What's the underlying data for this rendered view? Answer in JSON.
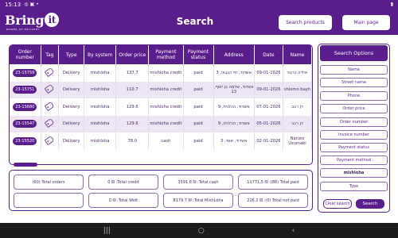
{
  "status_bar": {
    "time": "15:13",
    "icons_left": [
      "whatsapp-icon",
      "notification-icon",
      "dot"
    ],
    "battery": "battery-icon"
  },
  "app": {
    "logo_text": "Bring",
    "logo_it": "it",
    "logo_sub": "POWER OF DELIVERY",
    "title": "Search",
    "search_products": "Search products",
    "main_page": "Main page",
    "accent": "#5a1e8c"
  },
  "table": {
    "headers": [
      "Order number",
      "Tag",
      "Type",
      "By system",
      "Order price",
      "Payment method",
      "Payment status",
      "Address",
      "Date",
      "Name"
    ],
    "rows": [
      {
        "order": "23-15759",
        "type": "Delivery",
        "system": "mishloha",
        "price": "137.7",
        "method": "mishloha credit",
        "status": "paid",
        "address": "אשדוד, חיי הגבאי, 3",
        "date": "09-01-2026",
        "name": "איליה כרבני"
      },
      {
        "order": "23-15751",
        "type": "Delivery",
        "system": "mishloha",
        "price": "110.7",
        "method": "mishloha credit",
        "status": "paid",
        "address": "אשדוד, שלמה בן יוסף, 13",
        "date": "09-01-2026",
        "name": "shlomo bayh"
      },
      {
        "order": "23-15680",
        "type": "Delivery",
        "system": "mishloha",
        "price": "129.6",
        "method": "mishloha credit",
        "status": "paid",
        "address": "אשדוד, הכלנית, 9",
        "date": "07-01-2026",
        "name": "דן רבב"
      },
      {
        "order": "23-15547",
        "type": "Delivery",
        "system": "mishloha",
        "price": "129.6",
        "method": "mishloha credit",
        "status": "paid",
        "address": "אשדוד, הכלנית, 9",
        "date": "05-01-2026",
        "name": "דן רבב"
      },
      {
        "order": "23-15520",
        "type": "Delivery",
        "system": "mishloha",
        "price": "78.0",
        "method": "cash",
        "status": "paid",
        "address": "אשדוד, אוסי, 3",
        "date": "02-01-2026",
        "name": "Naruto Uzumaki"
      }
    ]
  },
  "summary": {
    "total_orders": "(60) Total orders",
    "total_credit": "0 ₪ :Total credit",
    "total_cash": "3591.8 ₪ :Total cash",
    "total_paid": "11771.5 ₪ :(88) Total paid",
    "empty": "",
    "total_wolt": "0 ₪ :Total Wolt",
    "total_mishloha": "8179.7 ₪ :Total MishLoha",
    "total_not_paid": "226.2 ₪ :(0) Total not paid"
  },
  "options": {
    "title": "Search Options",
    "fields": [
      "Name",
      "Street name",
      "Phone",
      "Order price",
      "Order number",
      "Invoice number",
      "Payment status",
      "Payment method",
      "mishloha",
      "Type"
    ],
    "clear": "Clear search",
    "search": "Search"
  },
  "nav": {
    "menu": "|||",
    "home": "○",
    "back": "‹"
  }
}
